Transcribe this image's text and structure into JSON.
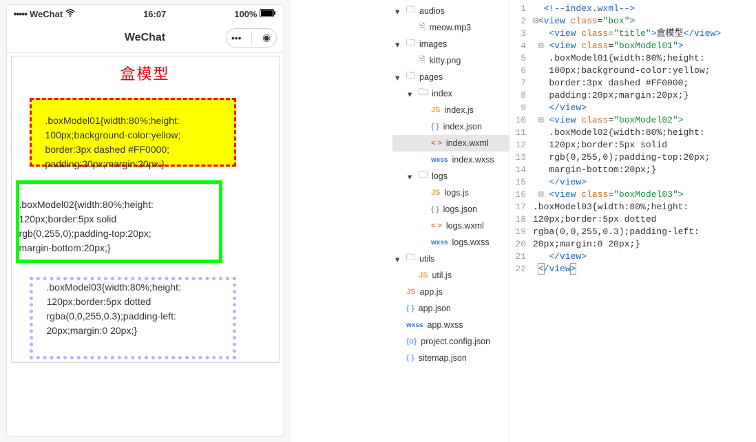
{
  "statusbar": {
    "carrier_dots": "•••••",
    "carrier": "WeChat",
    "time": "16:07",
    "battery": "100%"
  },
  "navbar": {
    "title": "WeChat",
    "more_glyph": "•••",
    "target_glyph": "◉"
  },
  "pageview": {
    "title": "盒模型",
    "box1": ".boxModel01{width:80%;height:\n100px;background-color:yellow;\nborder:3px dashed #FF0000;\npadding:20px;margin:20px;}",
    "box2": ".boxModel02{width:80%;height:\n120px;border:5px solid\nrgb(0,255,0);padding-top:20px;\nmargin-bottom:20px;}",
    "box3": ".boxModel03{width:80%;height:\n120px;border:5px dotted\nrgba(0,0,255,0.3);padding-left:\n20px;margin:0 20px;}"
  },
  "tree": {
    "items": [
      {
        "depth": 0,
        "caret": "▾",
        "iconType": "folder",
        "iconLabel": "🗀",
        "label": "audios",
        "selected": false
      },
      {
        "depth": 1,
        "caret": "",
        "iconType": "file",
        "iconLabel": "🗎",
        "label": "meow.mp3",
        "selected": false
      },
      {
        "depth": 0,
        "caret": "▾",
        "iconType": "folder",
        "iconLabel": "🗀",
        "label": "images",
        "selected": false
      },
      {
        "depth": 1,
        "caret": "",
        "iconType": "file",
        "iconLabel": "🗎",
        "label": "kitty.png",
        "selected": false
      },
      {
        "depth": 0,
        "caret": "▾",
        "iconType": "folder",
        "iconLabel": "🗀",
        "label": "pages",
        "selected": false
      },
      {
        "depth": 1,
        "caret": "▾",
        "iconType": "folder",
        "iconLabel": "🗀",
        "label": "index",
        "selected": false
      },
      {
        "depth": 2,
        "caret": "",
        "iconType": "js",
        "iconLabel": "JS",
        "label": "index.js",
        "selected": false
      },
      {
        "depth": 2,
        "caret": "",
        "iconType": "json",
        "iconLabel": "{ }",
        "label": "index.json",
        "selected": false
      },
      {
        "depth": 2,
        "caret": "",
        "iconType": "wxml",
        "iconLabel": "< >",
        "label": "index.wxml",
        "selected": true
      },
      {
        "depth": 2,
        "caret": "",
        "iconType": "wxss",
        "iconLabel": "wxss",
        "label": "index.wxss",
        "selected": false
      },
      {
        "depth": 1,
        "caret": "▾",
        "iconType": "folder",
        "iconLabel": "🗀",
        "label": "logs",
        "selected": false
      },
      {
        "depth": 2,
        "caret": "",
        "iconType": "js",
        "iconLabel": "JS",
        "label": "logs.js",
        "selected": false
      },
      {
        "depth": 2,
        "caret": "",
        "iconType": "json",
        "iconLabel": "{ }",
        "label": "logs.json",
        "selected": false
      },
      {
        "depth": 2,
        "caret": "",
        "iconType": "wxml",
        "iconLabel": "< >",
        "label": "logs.wxml",
        "selected": false
      },
      {
        "depth": 2,
        "caret": "",
        "iconType": "wxss",
        "iconLabel": "wxss",
        "label": "logs.wxss",
        "selected": false
      },
      {
        "depth": 0,
        "caret": "▾",
        "iconType": "folder",
        "iconLabel": "🗀",
        "label": "utils",
        "selected": false
      },
      {
        "depth": 1,
        "caret": "",
        "iconType": "js",
        "iconLabel": "JS",
        "label": "util.js",
        "selected": false
      },
      {
        "depth": 0,
        "caret": "",
        "iconType": "js",
        "iconLabel": "JS",
        "label": "app.js",
        "selected": false
      },
      {
        "depth": 0,
        "caret": "",
        "iconType": "json",
        "iconLabel": "{ }",
        "label": "app.json",
        "selected": false
      },
      {
        "depth": 0,
        "caret": "",
        "iconType": "wxss",
        "iconLabel": "wxss",
        "label": "app.wxss",
        "selected": false
      },
      {
        "depth": 0,
        "caret": "",
        "iconType": "json",
        "iconLabel": "{o}",
        "label": "project.config.json",
        "selected": false
      },
      {
        "depth": 0,
        "caret": "",
        "iconType": "json",
        "iconLabel": "{ }",
        "label": "sitemap.json",
        "selected": false
      }
    ]
  },
  "editor": {
    "lines": [
      {
        "num": 1,
        "html": "  <span class='tag'>&lt;!--index.wxml--&gt;</span>"
      },
      {
        "num": 2,
        "html": "<span class='gutter-brace'>⊟</span><span class='punct'>&lt;</span><span class='tag'>view</span> <span class='attr'>class</span>=<span class='str'>\"box\"</span><span class='punct'>&gt;</span>"
      },
      {
        "num": 3,
        "html": "   <span class='punct'>&lt;</span><span class='tag'>view</span> <span class='attr'>class</span>=<span class='str'>\"title\"</span><span class='punct'>&gt;</span><span class='text'>盒模型</span><span class='punct'>&lt;/</span><span class='tag'>view</span><span class='punct'>&gt;</span>"
      },
      {
        "num": 4,
        "html": " <span class='gutter-brace'>⊟</span> <span class='punct'>&lt;</span><span class='tag'>view</span> <span class='attr'>class</span>=<span class='str'>\"boxModel01\"</span><span class='punct'>&gt;</span>"
      },
      {
        "num": 5,
        "html": "   <span class='text'>.boxModel01{width:80%;height:</span>"
      },
      {
        "num": 6,
        "html": "   <span class='text'>100px;background-color:yellow;</span>"
      },
      {
        "num": 7,
        "html": "   <span class='text'>border:3px dashed #FF0000;</span>"
      },
      {
        "num": 8,
        "html": "   <span class='text'>padding:20px;margin:20px;}</span>"
      },
      {
        "num": 9,
        "html": "   <span class='punct'>&lt;/</span><span class='tag'>view</span><span class='punct'>&gt;</span>"
      },
      {
        "num": 10,
        "html": " <span class='gutter-brace'>⊟</span> <span class='punct'>&lt;</span><span class='tag'>view</span> <span class='attr'>class</span>=<span class='str'>\"boxModel02\"</span><span class='punct'>&gt;</span>"
      },
      {
        "num": 11,
        "html": "   <span class='text'>.boxModel02{width:80%;height:</span>"
      },
      {
        "num": 12,
        "html": "   <span class='text'>120px;border:5px solid</span>"
      },
      {
        "num": 13,
        "html": "   <span class='text'>rgb(0,255,0);padding-top:20px;</span>"
      },
      {
        "num": 14,
        "html": "   <span class='text'>margin-bottom:20px;}</span>"
      },
      {
        "num": 15,
        "html": "   <span class='punct'>&lt;/</span><span class='tag'>view</span><span class='punct'>&gt;</span>"
      },
      {
        "num": 16,
        "html": " <span class='gutter-brace'>⊟</span> <span class='punct'>&lt;</span><span class='tag'>view</span> <span class='attr'>class</span>=<span class='str'>\"boxModel03\"</span><span class='punct'>&gt;</span>"
      },
      {
        "num": 17,
        "html": "<span class='text'>.boxModel03{width:80%;height:</span>"
      },
      {
        "num": 18,
        "html": "<span class='text'>120px;border:5px dotted</span>"
      },
      {
        "num": 19,
        "html": "<span class='text'>rgba(0,0,255,0.3);padding-left:</span>"
      },
      {
        "num": 20,
        "html": "<span class='text'>20px;margin:0 20px;}</span>"
      },
      {
        "num": 21,
        "html": "   <span class='punct'>&lt;/</span><span class='tag'>view</span><span class='punct'>&gt;</span>"
      },
      {
        "num": 22,
        "html": " <span class='punct hlbox'>&lt;</span><span class='punct'>/</span><span class='tag'>view</span><span class='punct hlbox'>&gt;</span>"
      }
    ]
  }
}
